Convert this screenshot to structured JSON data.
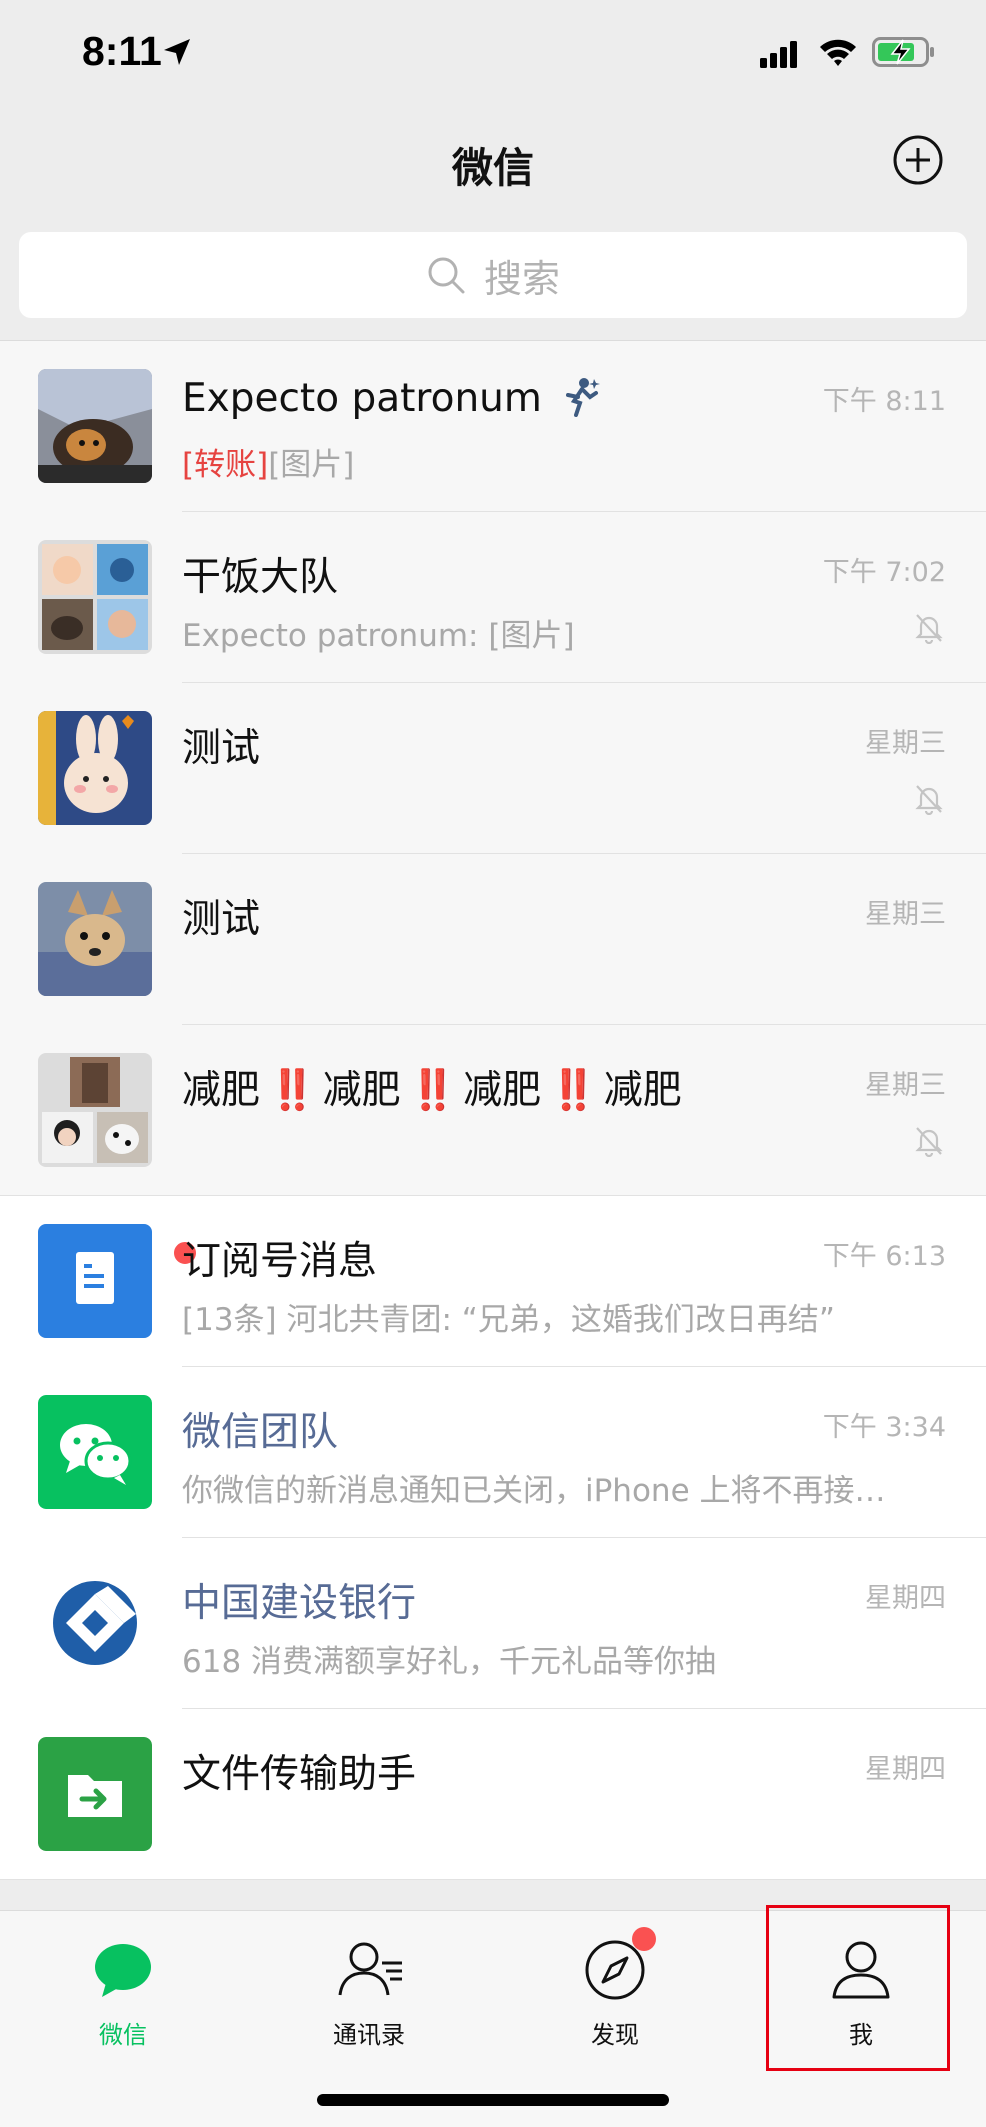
{
  "status_bar": {
    "time": "8:11"
  },
  "nav": {
    "title": "微信"
  },
  "search": {
    "placeholder": "搜索"
  },
  "chats": [
    {
      "name": "Expecto patronum",
      "preview_red": "[转账]",
      "preview": "[图片]",
      "time": "下午 8:11",
      "muted": false
    },
    {
      "name": "干饭大队",
      "preview": "Expecto patronum: [图片]",
      "time": "下午 7:02",
      "muted": true
    },
    {
      "name": "测试",
      "preview": "",
      "time": "星期三",
      "muted": true
    },
    {
      "name": "测试",
      "preview": "",
      "time": "星期三",
      "muted": false
    },
    {
      "name_parts": [
        "减肥",
        "减肥",
        "减肥",
        "减肥"
      ],
      "emoji": "‼️",
      "time": "星期三",
      "muted": true
    },
    {
      "name": "订阅号消息",
      "preview": "[13条] 河北共青团: “兄弟，这婚我们改日再结”",
      "time": "下午 6:13",
      "unread_dot": true
    },
    {
      "name": "微信团队",
      "preview": "你微信的新消息通知已关闭，iPhone 上将不再接…",
      "time": "下午 3:34"
    },
    {
      "name": "中国建设银行",
      "preview": "618 消费满额享好礼，千元礼品等你抽",
      "time": "星期四"
    },
    {
      "name": "文件传输助手",
      "preview": "",
      "time": "星期四"
    }
  ],
  "tabs": [
    {
      "label": "微信",
      "icon": "chat-bubble-icon",
      "active": true
    },
    {
      "label": "通讯录",
      "icon": "contacts-icon"
    },
    {
      "label": "发现",
      "icon": "compass-icon",
      "badge_dot": true
    },
    {
      "label": "我",
      "icon": "person-icon",
      "highlighted": true
    }
  ],
  "colors": {
    "wechat_green": "#07c160",
    "official_blue": "#576b95",
    "badge_red": "#fa5151",
    "highlight_red": "#e60012"
  }
}
